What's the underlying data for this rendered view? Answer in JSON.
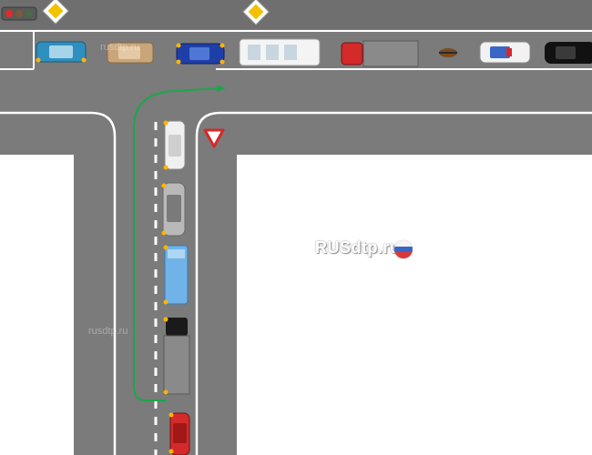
{
  "watermarks": {
    "main": "RUSdtp.ru",
    "top": "rusdtp.ru",
    "left": "rusdtp.ru"
  },
  "colors": {
    "road": "#7b7b7b",
    "road_edge": "#6d6d6d",
    "marking": "#ffffff",
    "background": "#ffffff",
    "route_arrow": "#1ca64a",
    "turn_signal": "#ffb400"
  },
  "signs": [
    {
      "name": "priority-road-sign",
      "type": "priority road"
    },
    {
      "name": "priority-road-sign-2",
      "type": "priority road"
    },
    {
      "name": "yield-sign",
      "type": "give way"
    },
    {
      "name": "traffic-light",
      "type": "traffic light"
    }
  ],
  "vehicles_main_road": [
    {
      "name": "car-teal",
      "color": "#2f8fbf",
      "turn_signals": true
    },
    {
      "name": "car-tan",
      "color": "#c9a57a",
      "turn_signals": false
    },
    {
      "name": "car-blue",
      "color": "#1e3fa8",
      "turn_signals": true
    },
    {
      "name": "white-minibus",
      "color": "#f4f4f4",
      "turn_signals": false
    },
    {
      "name": "red-truck",
      "color": "#d42a2a",
      "turn_signals": false
    },
    {
      "name": "motorcycle",
      "color": "#7a4a1e",
      "turn_signals": false
    },
    {
      "name": "police-car",
      "color": "#f2f2f2",
      "turn_signals": false
    },
    {
      "name": "black-car",
      "color": "#111111",
      "turn_signals": false
    }
  ],
  "vehicles_side_road": [
    {
      "name": "white-car",
      "color": "#f0f0f0",
      "turn_signals": true
    },
    {
      "name": "silver-car",
      "color": "#b9b9b9",
      "turn_signals": true
    },
    {
      "name": "blue-van",
      "color": "#6fb3e8",
      "turn_signals": true
    },
    {
      "name": "gray-truck",
      "color": "#1a1a1a",
      "turn_signals": true
    },
    {
      "name": "red-car",
      "color": "#d42a2a",
      "turn_signals": true
    }
  ]
}
